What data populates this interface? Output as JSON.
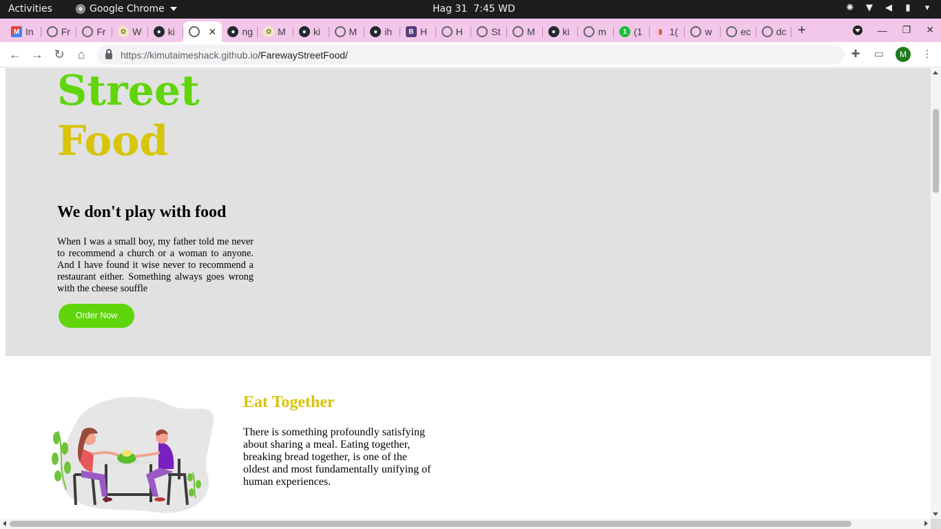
{
  "system_bar": {
    "activities": "Activities",
    "app_name": "Google Chrome",
    "date": "Hag 31",
    "time": "7:45 WD"
  },
  "tabs": [
    {
      "favicon": "gmail",
      "label": "In"
    },
    {
      "favicon": "globe",
      "label": "Fr"
    },
    {
      "favicon": "globe",
      "label": "Fr"
    },
    {
      "favicon": "plant",
      "label": "W"
    },
    {
      "favicon": "github",
      "label": "ki"
    },
    {
      "favicon": "globe",
      "label": "",
      "active": true
    },
    {
      "favicon": "github",
      "label": "ng"
    },
    {
      "favicon": "plant",
      "label": "M"
    },
    {
      "favicon": "github",
      "label": "ki"
    },
    {
      "favicon": "globe",
      "label": "M"
    },
    {
      "favicon": "github",
      "label": "ih"
    },
    {
      "favicon": "bootstrap",
      "label": "H"
    },
    {
      "favicon": "globe",
      "label": "H"
    },
    {
      "favicon": "globe",
      "label": "St"
    },
    {
      "favicon": "globe",
      "label": "M"
    },
    {
      "favicon": "github",
      "label": "ki"
    },
    {
      "favicon": "globe",
      "label": "m"
    },
    {
      "favicon": "green",
      "label": "(1"
    },
    {
      "favicon": "bars",
      "label": "1("
    },
    {
      "favicon": "globe",
      "label": "w"
    },
    {
      "favicon": "globe",
      "label": "ec"
    },
    {
      "favicon": "globe",
      "label": "dc"
    }
  ],
  "address_bar": {
    "url_host": "https://kimutaimeshack.github.io",
    "url_path": "/FarewayStreetFood/",
    "profile_initial": "M"
  },
  "page": {
    "brand_line1": "Street",
    "brand_line2": "Food",
    "tagline": "We don't play with food",
    "hero_text": "When I was a small boy, my father told me never to recommend a church or a woman to anyone. And I have found it wise never to recommend a restaurant either. Something always goes wrong with the cheese souffle",
    "order_button": "Order Now",
    "eat_title": "Eat Together",
    "eat_text": "There is something profoundly satisfying about sharing a meal. Eating together, breaking bread together, is one of the oldest and most fundamentally unifying of human experiences."
  },
  "colors": {
    "brand_green": "#5fd50a",
    "brand_yellow": "#d8c40a",
    "hero_bg": "#e0e1e0",
    "tabstrip_bg": "#f2c7e9"
  }
}
